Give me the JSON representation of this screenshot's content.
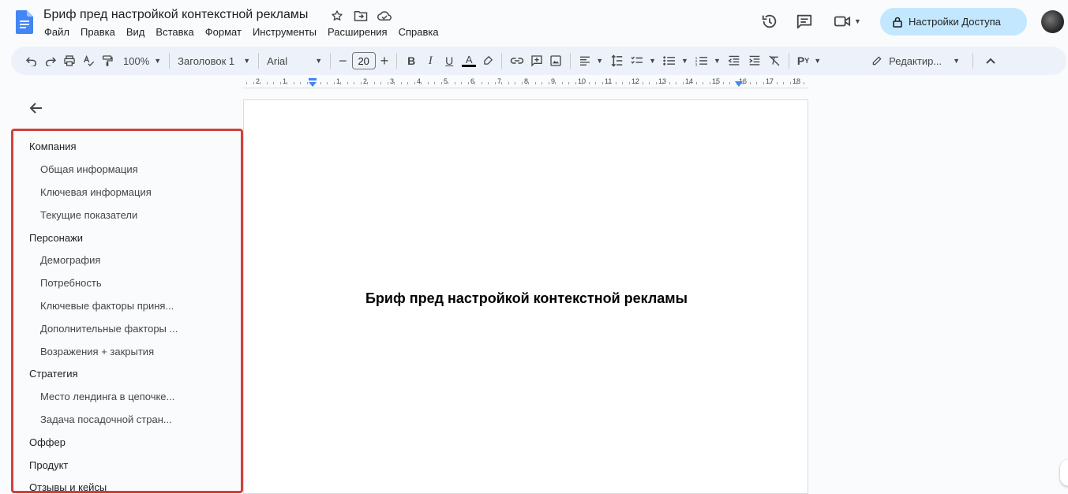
{
  "app": {
    "title": "Бриф пред настройкой контекстной рекламы",
    "accent_color": "#1a73e8",
    "share_bg": "#c2e7ff"
  },
  "menu": [
    "Файл",
    "Правка",
    "Вид",
    "Вставка",
    "Формат",
    "Инструменты",
    "Расширения",
    "Справка"
  ],
  "header": {
    "share_label": "Настройки Доступа",
    "icons": [
      "star-icon",
      "move-folder-icon",
      "cloud-saved-icon",
      "history-icon",
      "comment-icon",
      "meet-icon",
      "lock-icon"
    ]
  },
  "toolbar": {
    "zoom": "100%",
    "style": "Заголовок 1",
    "font": "Arial",
    "font_size": "20",
    "mode_label": "Редактир...",
    "paragraph_style_label": "P"
  },
  "ruler": {
    "ticks": [
      "2",
      "1",
      "1",
      "2",
      "3",
      "4",
      "5",
      "6",
      "7",
      "8",
      "9",
      "10",
      "11",
      "12",
      "13",
      "14",
      "15",
      "16",
      "17",
      "18"
    ]
  },
  "outline": {
    "items": [
      {
        "label": "Компания",
        "level": 1
      },
      {
        "label": "Общая информация",
        "level": 2
      },
      {
        "label": "Ключевая информация",
        "level": 2
      },
      {
        "label": "Текущие показатели",
        "level": 2
      },
      {
        "label": "Персонажи",
        "level": 1
      },
      {
        "label": "Демография",
        "level": 2
      },
      {
        "label": "Потребность",
        "level": 2
      },
      {
        "label": "Ключевые факторы приня...",
        "level": 2
      },
      {
        "label": "Дополнительные факторы ...",
        "level": 2
      },
      {
        "label": "Возражения + закрытия",
        "level": 2
      },
      {
        "label": "Стратегия",
        "level": 1
      },
      {
        "label": "Место лендинга в цепочке...",
        "level": 2
      },
      {
        "label": "Задача посадочной стран...",
        "level": 2
      },
      {
        "label": "Оффер",
        "level": 1
      },
      {
        "label": "Продукт",
        "level": 1
      },
      {
        "label": "Отзывы и кейсы",
        "level": 1
      }
    ]
  },
  "document": {
    "heading": "Бриф пред настройкой контекстной рекламы"
  }
}
